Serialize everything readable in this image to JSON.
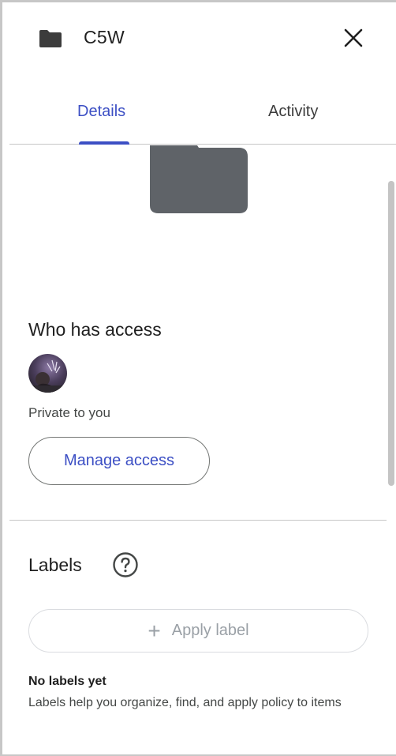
{
  "header": {
    "title": "C5W",
    "folder_icon": "folder-icon",
    "close_icon": "close-icon"
  },
  "tabs": [
    {
      "label": "Details",
      "active": true
    },
    {
      "label": "Activity",
      "active": false
    }
  ],
  "access": {
    "title": "Who has access",
    "avatar_icon": "avatar",
    "status": "Private to you",
    "manage_label": "Manage access"
  },
  "labels": {
    "title": "Labels",
    "help_icon": "help-circle-icon",
    "apply_label": "Apply label",
    "empty_title": "No labels yet",
    "empty_description": "Labels help you organize, find, and apply policy to items"
  },
  "colors": {
    "accent": "#3c4fc4",
    "folder": "#5f6368",
    "divider": "#c7c7c7"
  }
}
